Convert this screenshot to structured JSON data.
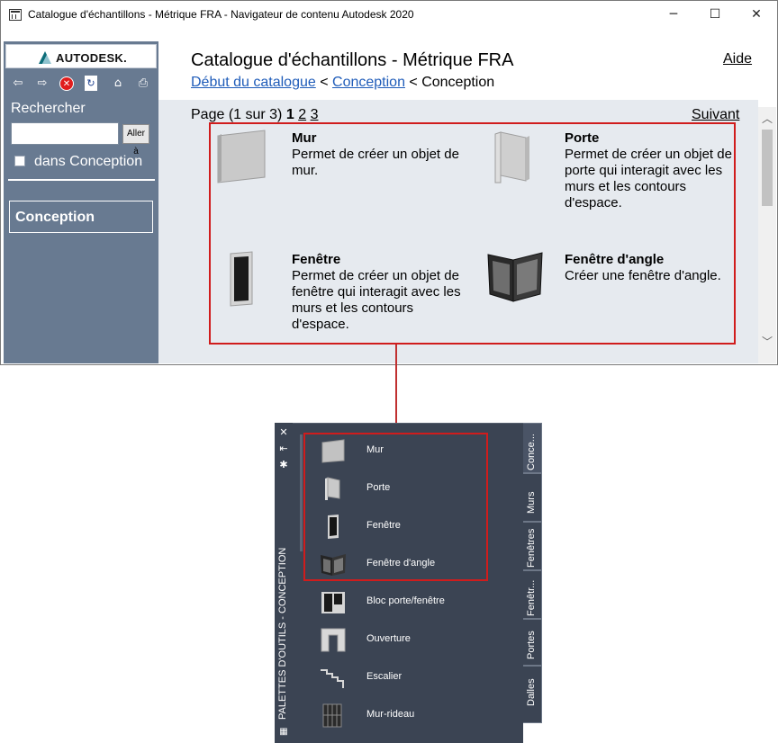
{
  "window": {
    "title": "Catalogue d'échantillons - Métrique FRA - Navigateur de contenu Autodesk 2020",
    "controls": {
      "minimize": "─",
      "maximize": "☐",
      "close": "✕"
    }
  },
  "sidebar": {
    "logo_text": "AUTODESK.",
    "toolbar_icons": [
      "back-arrow-icon",
      "forward-arrow-icon",
      "stop-icon",
      "refresh-icon",
      "home-icon",
      "print-icon"
    ],
    "search_label": "Rechercher",
    "search_value": "",
    "search_button": "Aller à",
    "scope_checkbox_label": "dans Conception",
    "scope_checked": false,
    "nav_item": "Conception"
  },
  "header": {
    "title": "Catalogue d'échantillons - Métrique FRA",
    "help_link": "Aide",
    "breadcrumb": {
      "root": "Début du catalogue",
      "sep1": " < ",
      "level1": "Conception",
      "sep2": " < ",
      "current": "Conception"
    }
  },
  "pagination": {
    "label": "Page (1 sur 3)",
    "current": "1",
    "pages": [
      "2",
      "3"
    ],
    "next": "Suivant"
  },
  "catalog_items": [
    {
      "name": "Mur",
      "description": "Permet de créer un objet de mur."
    },
    {
      "name": "Porte",
      "description": "Permet de créer un objet de porte qui interagit avec les murs et les contours d'espace."
    },
    {
      "name": "Fenêtre",
      "description": "Permet de créer un objet de fenêtre qui interagit avec les murs et les contours d'espace."
    },
    {
      "name": "Fenêtre d'angle",
      "description": "Créer une fenêtre d'angle."
    }
  ],
  "palette": {
    "vertical_title": "PALETTES D'OUTILS - CONCEPTION",
    "controls": {
      "close": "✕",
      "autohide": "⇤",
      "properties": "✱"
    },
    "items": [
      "Mur",
      "Porte",
      "Fenêtre",
      "Fenêtre d'angle",
      "Bloc porte/fenêtre",
      "Ouverture",
      "Escalier",
      "Mur-rideau"
    ],
    "tabs": [
      "Conce...",
      "Murs",
      "Fenêtres",
      "Fenêtr...",
      "Portes",
      "Dalles"
    ],
    "active_tab": "Conce..."
  },
  "colors": {
    "sidebar_bg": "#687a91",
    "content_bg": "#e6eaef",
    "link": "#1f5cb9",
    "highlight": "#d01c1c",
    "palette_bg": "#3b4453"
  }
}
